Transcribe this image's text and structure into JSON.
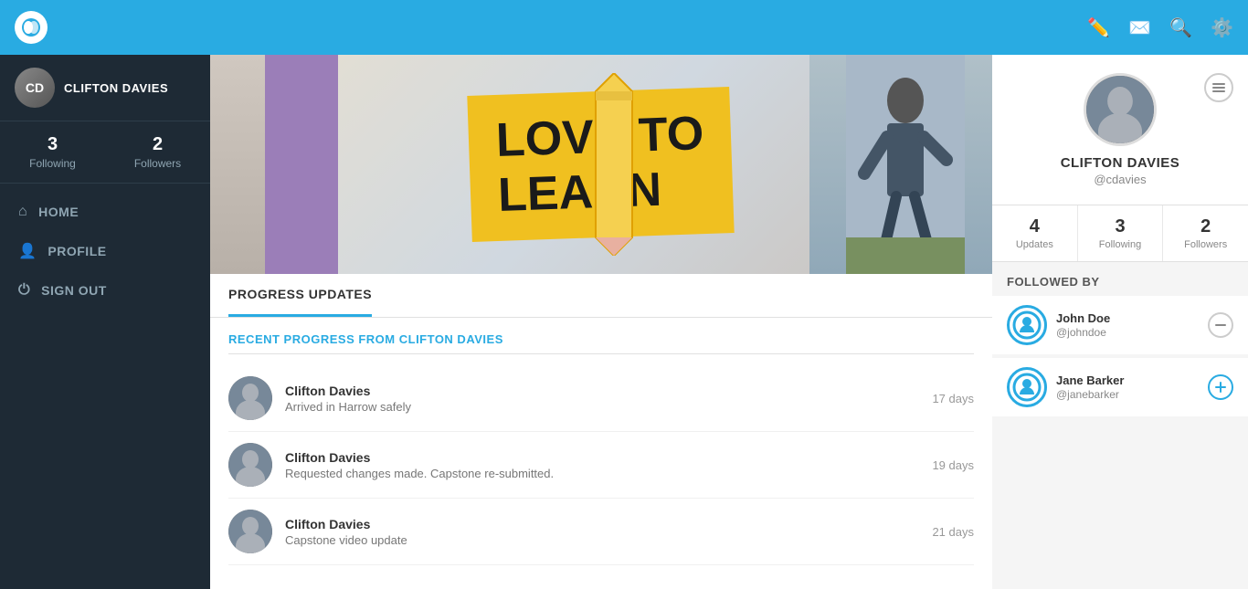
{
  "topbar": {
    "logo_text": "⬤◐",
    "edit_icon": "✏",
    "mail_icon": "✉",
    "search_icon": "🔍",
    "settings_icon": "⚙"
  },
  "sidebar": {
    "username": "CLIFTON DAVIES",
    "following_count": "3",
    "following_label": "Following",
    "followers_count": "2",
    "followers_label": "Followers",
    "nav": [
      {
        "label": "HOME",
        "icon": "⌂"
      },
      {
        "label": "PROFILE",
        "icon": "👤"
      },
      {
        "label": "SIGN OUT",
        "icon": "⏻"
      }
    ]
  },
  "banner": {
    "text_line1": "LOVE to",
    "text_line2": "LEARN"
  },
  "progress_section": {
    "tab_label": "PROGRESS UPDATES",
    "recent_title": "RECENT PROGRESS FROM CLIFTON DAVIES",
    "items": [
      {
        "name": "Clifton Davies",
        "description": "Arrived in Harrow safely",
        "time": "17 days"
      },
      {
        "name": "Clifton Davies",
        "description": "Requested changes made. Capstone re-submitted.",
        "time": "19 days"
      },
      {
        "name": "Clifton Davies",
        "description": "Capstone video update",
        "time": "21 days"
      }
    ]
  },
  "right_panel": {
    "profile": {
      "name": "CLIFTON DAVIES",
      "handle": "@cdavies"
    },
    "stats": [
      {
        "number": "4",
        "label": "Updates"
      },
      {
        "number": "3",
        "label": "Following"
      },
      {
        "number": "2",
        "label": "Followers"
      }
    ],
    "followed_by_label": "FOLLOWED BY",
    "followers": [
      {
        "name": "John Doe",
        "handle": "@johndoe",
        "action": "remove"
      },
      {
        "name": "Jane Barker",
        "handle": "@janebarker",
        "action": "add"
      }
    ]
  }
}
